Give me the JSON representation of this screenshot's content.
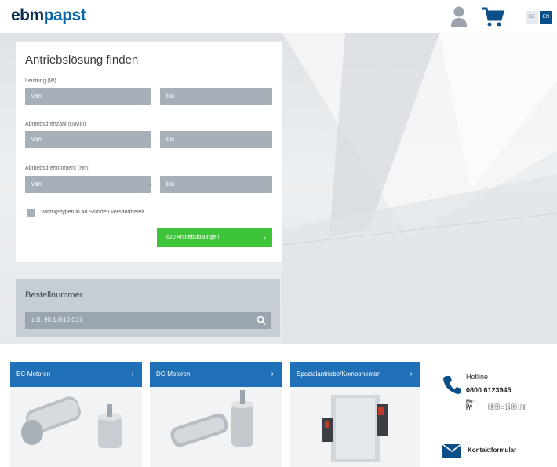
{
  "header": {
    "logo_part1": "ebm",
    "logo_part2": "papst",
    "icons": [
      "user-icon",
      "cart-icon"
    ],
    "languages": [
      "DE",
      "EN"
    ]
  },
  "finder": {
    "title": "Antriebslösung finden",
    "fields": [
      {
        "label": "Leistung (W)",
        "from_placeholder": "von",
        "to_placeholder": "bis"
      },
      {
        "label": "Abtriebsdrehzahl (U/Min)",
        "from_placeholder": "von",
        "to_placeholder": "bis"
      },
      {
        "label": "Abtriebsdrehmoment (Nm)",
        "from_placeholder": "von",
        "to_placeholder": "bis"
      }
    ],
    "checkbox_label": "Vorzugstypen in 48 Stunden versandbereit",
    "result_button": "620 Antriebslösungen",
    "arrow": "›",
    "dash": "–"
  },
  "order": {
    "title": "Bestellnummer",
    "placeholder": "z.B. 90.1.G10.C10"
  },
  "tiles": [
    {
      "label": "EC-Motoren",
      "arrow": "›"
    },
    {
      "label": "DC-Motoren",
      "arrow": "›"
    },
    {
      "label": "Spezialantriebe/Komponenten",
      "arrow": "›"
    }
  ],
  "hotline": {
    "title": "Hotline",
    "number": "0800 6123945",
    "hours": [
      {
        "days": "Mo - Do",
        "time": "08:00 – 17:00 Uhr"
      },
      {
        "days": "Fr",
        "time": "08:00 – 14:00 Uhr"
      }
    ],
    "contact_label": "Kontaktformular"
  },
  "colors": {
    "accent_blue": "#2070b8",
    "brand_dark": "#0b2c4e",
    "green": "#3ec439",
    "input_gray": "#a7b0b8"
  }
}
